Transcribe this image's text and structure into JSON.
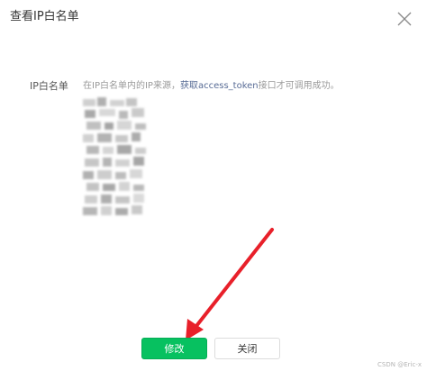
{
  "dialog": {
    "title": "查看IP白名单",
    "close_icon": "close-icon"
  },
  "form": {
    "label": "IP白名单",
    "hint_prefix": "在IP白名单内的IP来源，",
    "hint_link": "获取access_token",
    "hint_suffix": "接口才可调用成功。"
  },
  "ip_list": {
    "blurred": true
  },
  "buttons": {
    "modify": "修改",
    "close": "关闭"
  },
  "annotation": {
    "arrow_color": "#e8202a"
  },
  "watermark": "CSDN @Eric-x",
  "colors": {
    "primary": "#07c160",
    "link": "#576b95"
  }
}
